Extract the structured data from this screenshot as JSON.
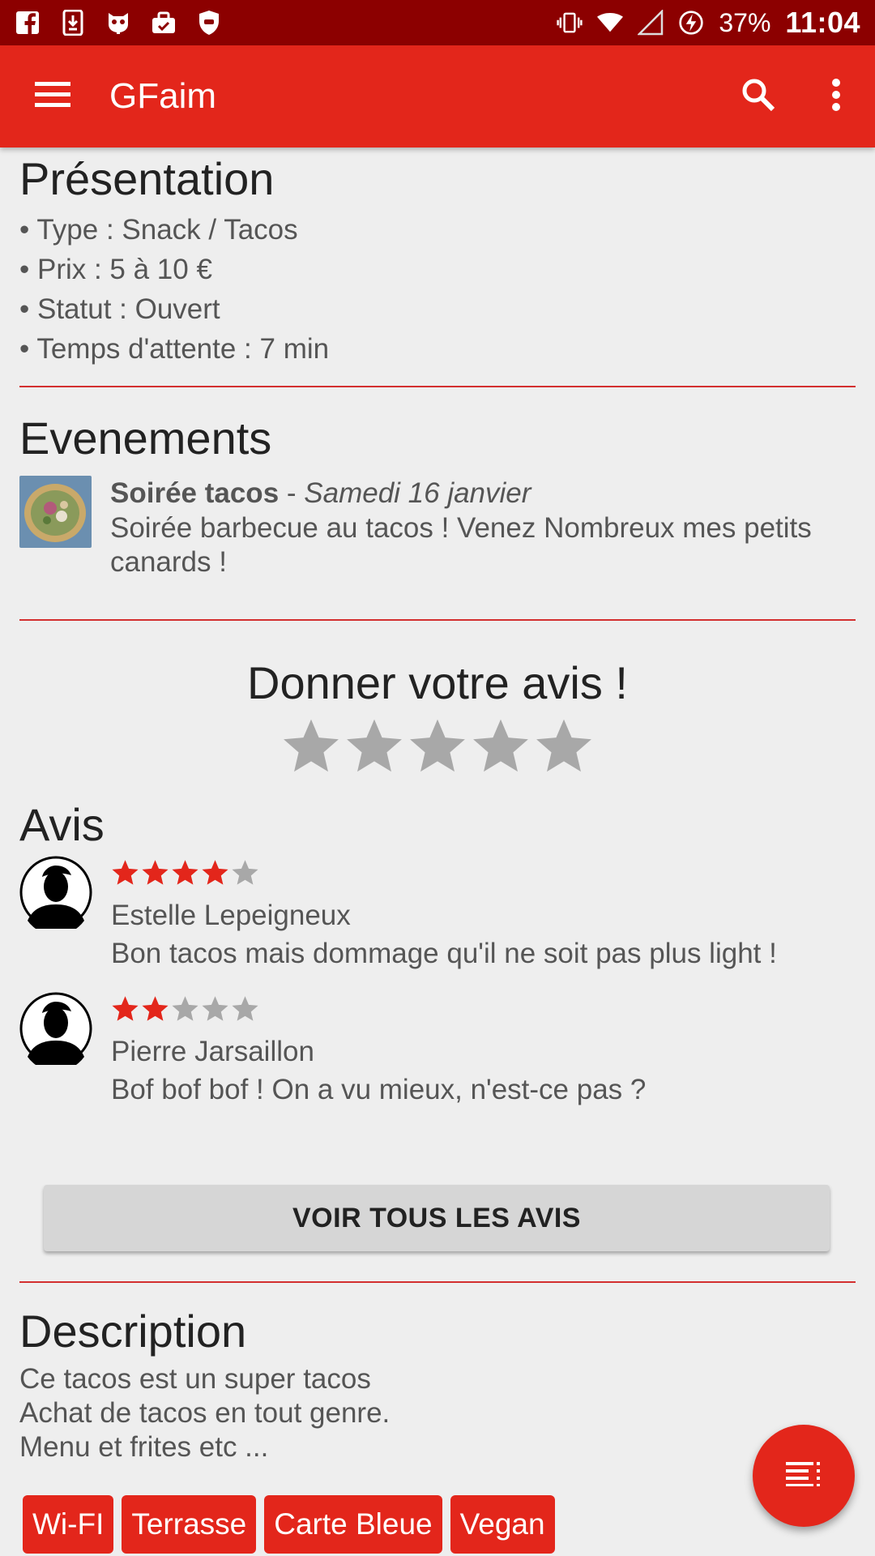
{
  "status_bar": {
    "battery": "37%",
    "time": "11:04",
    "icons": [
      "facebook-icon",
      "download-icon",
      "cyanogen-icon",
      "briefcase-icon",
      "shield-icon",
      "vibrate-icon",
      "wifi-icon",
      "signal-icon",
      "battery-charging-icon"
    ]
  },
  "app_bar": {
    "title": "GFaim",
    "icons": [
      "menu-icon",
      "search-icon",
      "more-vert-icon"
    ]
  },
  "presentation": {
    "title": "Présentation",
    "items": [
      "• Type : Snack / Tacos",
      "• Prix : 5 à 10 €",
      "• Statut : Ouvert",
      "• Temps d'attente : 7 min"
    ]
  },
  "events": {
    "title": "Evenements",
    "item": {
      "name": "Soirée tacos",
      "separator": " - ",
      "date": "Samedi 16 janvier",
      "description": "Soirée barbecue au tacos ! Venez Nombreux mes petits canards !"
    }
  },
  "rate": {
    "title": "Donner votre avis !",
    "rating": 0,
    "max": 5
  },
  "reviews": {
    "title": "Avis",
    "items": [
      {
        "rating": 4,
        "max": 5,
        "author": "Estelle Lepeigneux",
        "text": "Bon tacos mais dommage qu'il ne soit pas plus light !"
      },
      {
        "rating": 2,
        "max": 5,
        "author": "Pierre Jarsaillon",
        "text": "Bof bof bof ! On a vu mieux, n'est-ce pas ?"
      }
    ],
    "see_all_label": "VOIR TOUS LES AVIS"
  },
  "description": {
    "title": "Description",
    "lines": [
      "Ce tacos est un super tacos",
      "Achat de tacos en tout genre.",
      "Menu et frites etc ..."
    ]
  },
  "tags": [
    "Wi-FI",
    "Terrasse",
    "Carte Bleue",
    "Vegan"
  ],
  "fab": {
    "icon": "sort-list-icon"
  },
  "colors": {
    "primary": "#e3261b",
    "status_bar": "#8c0000",
    "divider": "#d32f2f",
    "star_filled": "#e3261b",
    "star_empty": "#a8a8a8"
  }
}
